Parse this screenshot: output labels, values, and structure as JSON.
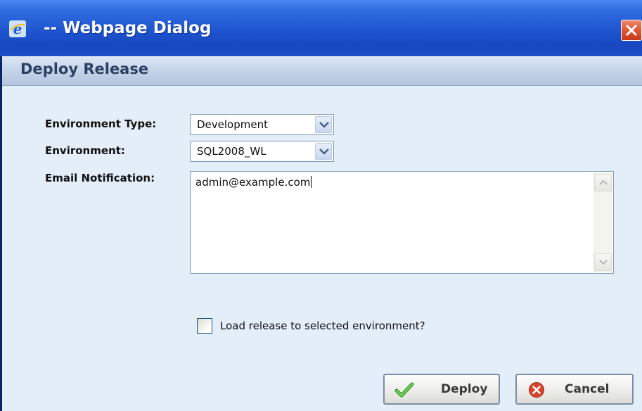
{
  "window": {
    "title": "-- Webpage Dialog"
  },
  "dialog": {
    "heading": "Deploy Release"
  },
  "form": {
    "environment_type": {
      "label": "Environment Type:",
      "value": "Development"
    },
    "environment": {
      "label": "Environment:",
      "value": "SQL2008_WL"
    },
    "email_notification": {
      "label": "Email Notification:",
      "value": "admin@example.com"
    },
    "load_release": {
      "label": "Load release to selected environment?",
      "checked": false
    }
  },
  "buttons": {
    "deploy_label": "Deploy",
    "cancel_label": "Cancel"
  },
  "colors": {
    "titlebar": "#1f55d0",
    "client_background": "#e4eef9",
    "close_button": "#e25a36"
  },
  "icons": [
    "ie-icon",
    "close-icon",
    "chevron-down-icon",
    "scroll-up-icon",
    "scroll-down-icon",
    "checkmark-icon",
    "cancel-x-icon"
  ]
}
